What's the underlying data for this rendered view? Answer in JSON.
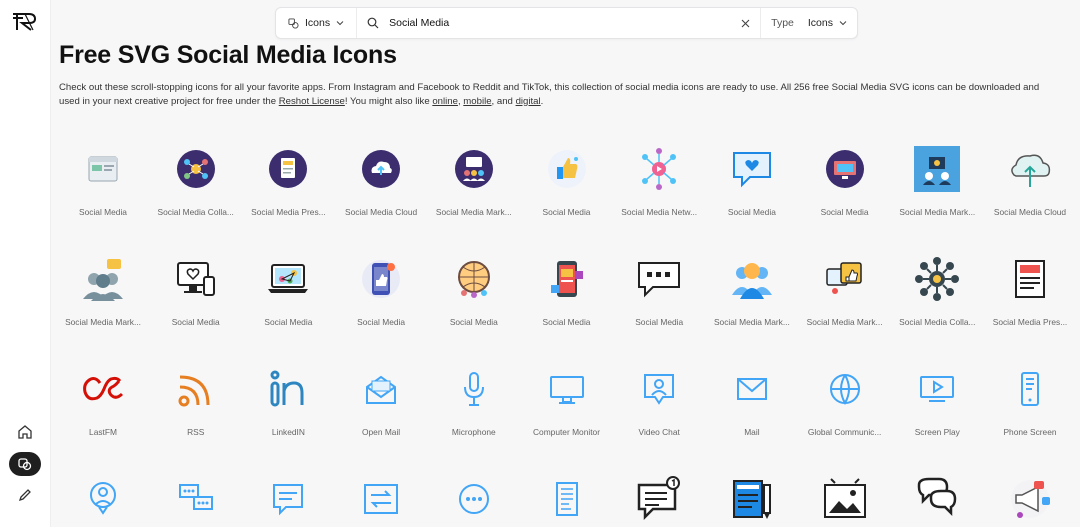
{
  "search": {
    "asset_type": "Icons",
    "query": "Social Media",
    "type_label": "Type",
    "type_value": "Icons"
  },
  "page": {
    "title": "Free SVG Social Media Icons",
    "desc_1": "Check out these scroll-stopping icons for all your favorite apps. From Instagram and Facebook to Reddit and TikTok, this collection of social media icons are ready to use. All 256 free Social Media SVG icons can be downloaded and used in your next creative project for free under the ",
    "license_link": "Reshot License",
    "desc_2": "! You might also like ",
    "link_online": "online",
    "sep_1": ", ",
    "link_mobile": "mobile",
    "sep_2": ", and ",
    "link_digital": "digital",
    "desc_end": "."
  },
  "sidebar": {
    "icons": [
      "home-icon",
      "collections-icon",
      "pencil-icon"
    ]
  },
  "icons": [
    {
      "label": "Social Media",
      "icon": "browser-window-icon"
    },
    {
      "label": "Social Media Colla...",
      "icon": "network-circle-icon"
    },
    {
      "label": "Social Media Pres...",
      "icon": "document-circle-icon"
    },
    {
      "label": "Social Media Cloud",
      "icon": "cloud-upload-circle-icon"
    },
    {
      "label": "Social Media Mark...",
      "icon": "team-circle-icon"
    },
    {
      "label": "Social Media",
      "icon": "thumbs-up-icon"
    },
    {
      "label": "Social Media Netw...",
      "icon": "play-network-icon"
    },
    {
      "label": "Social Media",
      "icon": "heart-chat-icon"
    },
    {
      "label": "Social Media",
      "icon": "monitor-circle-icon"
    },
    {
      "label": "Social Media Mark...",
      "icon": "marketing-square-icon"
    },
    {
      "label": "Social Media Cloud",
      "icon": "cloud-arrow-icon"
    },
    {
      "label": "Social Media Mark...",
      "icon": "users-chat-icon"
    },
    {
      "label": "Social Media",
      "icon": "devices-heart-icon"
    },
    {
      "label": "Social Media",
      "icon": "laptop-network-icon"
    },
    {
      "label": "Social Media",
      "icon": "phone-like-icon"
    },
    {
      "label": "Social Media",
      "icon": "globe-people-icon"
    },
    {
      "label": "Social Media",
      "icon": "mobile-media-icon"
    },
    {
      "label": "Social Media",
      "icon": "chat-dots-icon"
    },
    {
      "label": "Social Media Mark...",
      "icon": "users-icon"
    },
    {
      "label": "Social Media Mark...",
      "icon": "like-chat-icon"
    },
    {
      "label": "Social Media Colla...",
      "icon": "hub-nodes-icon"
    },
    {
      "label": "Social Media Pres...",
      "icon": "newspaper-icon"
    },
    {
      "label": "LastFM",
      "icon": "lastfm-icon"
    },
    {
      "label": "RSS",
      "icon": "rss-icon"
    },
    {
      "label": "LinkedIN",
      "icon": "linkedin-icon"
    },
    {
      "label": "Open Mail",
      "icon": "open-mail-icon"
    },
    {
      "label": "Microphone",
      "icon": "microphone-icon"
    },
    {
      "label": "Computer Monitor",
      "icon": "monitor-icon"
    },
    {
      "label": "Video Chat",
      "icon": "video-chat-icon"
    },
    {
      "label": "Mail",
      "icon": "mail-icon"
    },
    {
      "label": "Global Communic...",
      "icon": "globe-icon"
    },
    {
      "label": "Screen Play",
      "icon": "screen-play-icon"
    },
    {
      "label": "Phone Screen",
      "icon": "phone-icon"
    },
    {
      "label": "",
      "icon": "profile-chat-icon"
    },
    {
      "label": "",
      "icon": "chat-bubbles-icon"
    },
    {
      "label": "",
      "icon": "chat-lines-icon"
    },
    {
      "label": "",
      "icon": "repeat-icon"
    },
    {
      "label": "",
      "icon": "chat-circle-icon"
    },
    {
      "label": "",
      "icon": "document-icon"
    },
    {
      "label": "",
      "icon": "notification-chat-icon"
    },
    {
      "label": "",
      "icon": "notepad-pen-icon"
    },
    {
      "label": "",
      "icon": "gallery-icon"
    },
    {
      "label": "",
      "icon": "two-chats-icon"
    },
    {
      "label": "",
      "icon": "megaphone-icon"
    }
  ]
}
